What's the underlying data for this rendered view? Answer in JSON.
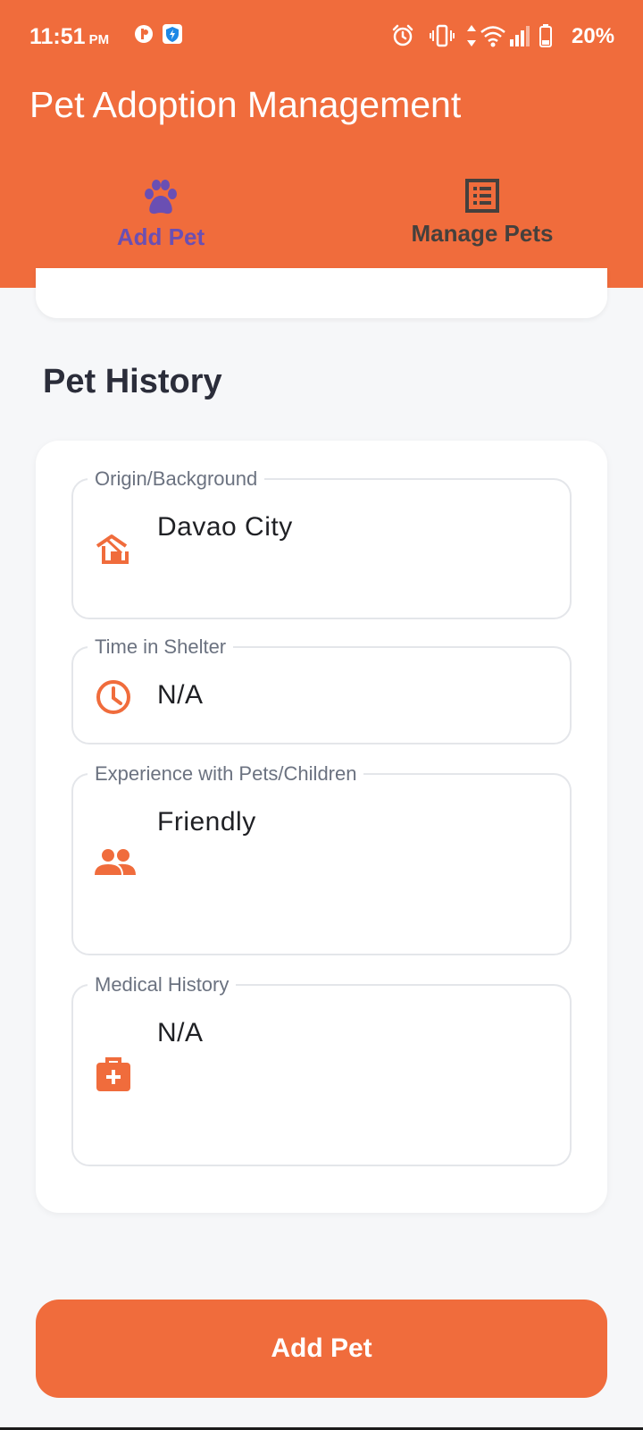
{
  "status_bar": {
    "time": "11:51",
    "ampm": "PM",
    "battery": "20%"
  },
  "app": {
    "title": "Pet Adoption Management",
    "accent_color": "#f06c3c",
    "active_tab_color": "#6a4fb3"
  },
  "tabs": [
    {
      "label": "Add Pet",
      "icon": "paw-icon",
      "active": true
    },
    {
      "label": "Manage Pets",
      "icon": "list-icon",
      "active": false
    }
  ],
  "section": {
    "title": "Pet History"
  },
  "fields": [
    {
      "label": "Origin/Background",
      "value": "Davao City",
      "icon": "shelter-icon"
    },
    {
      "label": "Time in Shelter",
      "value": "N/A",
      "icon": "clock-icon"
    },
    {
      "label": "Experience with Pets/Children",
      "value": "Friendly",
      "icon": "people-icon"
    },
    {
      "label": "Medical History",
      "value": "N/A",
      "icon": "medical-kit-icon"
    }
  ],
  "submit": {
    "label": "Add Pet"
  }
}
